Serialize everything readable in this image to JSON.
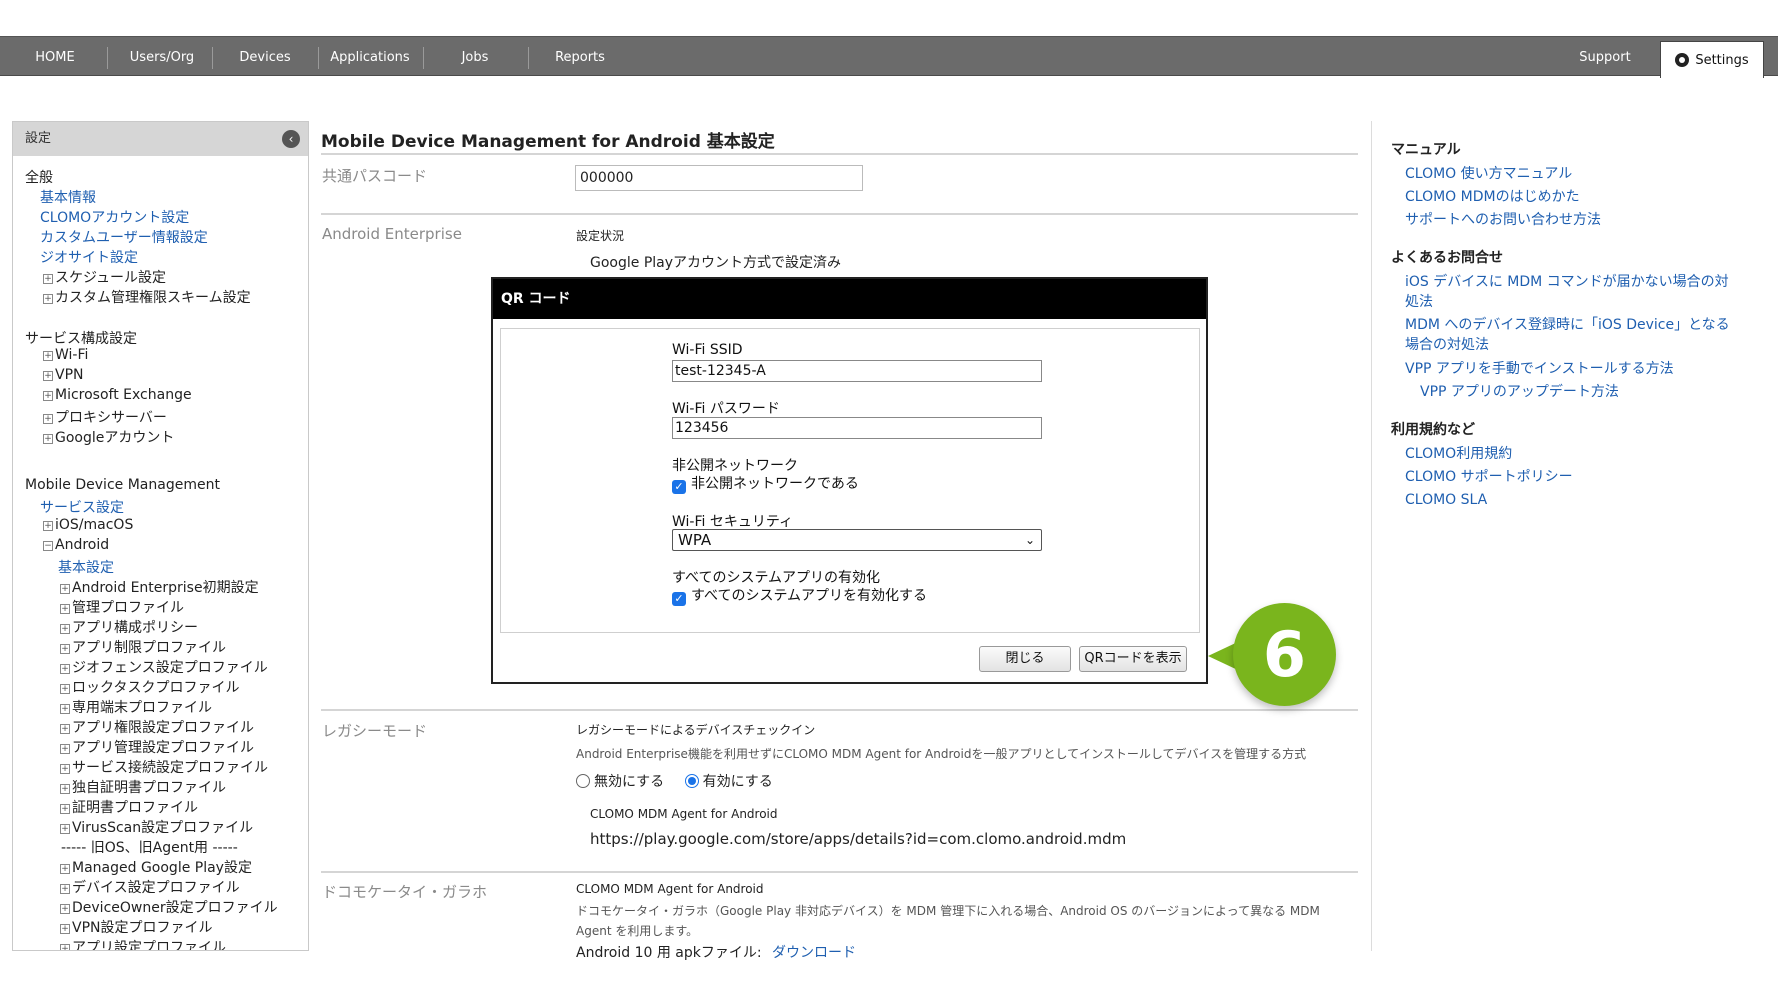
{
  "nav": {
    "items": [
      "HOME",
      "Users/Org",
      "Devices",
      "Applications",
      "Jobs",
      "Reports"
    ],
    "support": "Support",
    "settings": "Settings"
  },
  "sidebar": {
    "title": "設定",
    "collapse_icon": "chevron-left-icon",
    "lines": [
      {
        "text": "全般",
        "type": "heading"
      },
      {
        "text": "基本情報",
        "type": "link"
      },
      {
        "text": "CLOMOアカウント設定",
        "type": "link"
      },
      {
        "text": "カスタムユーザー情報設定",
        "type": "link"
      },
      {
        "text": "ジオサイト設定",
        "type": "link"
      },
      {
        "text": "スケジュール設定",
        "type": "tree"
      },
      {
        "text": "カスタム管理権限スキーム設定",
        "type": "tree"
      },
      {
        "text": "サービス構成設定",
        "type": "heading"
      },
      {
        "text": "Wi-Fi",
        "type": "tree"
      },
      {
        "text": "VPN",
        "type": "tree"
      },
      {
        "text": "Microsoft Exchange",
        "type": "tree"
      },
      {
        "text": "プロキシサーバー",
        "type": "tree"
      },
      {
        "text": "Googleアカウント",
        "type": "tree"
      },
      {
        "text": "Mobile Device Management",
        "type": "heading"
      },
      {
        "text": "サービス設定",
        "type": "link"
      },
      {
        "text": "iOS/macOS",
        "type": "tree"
      },
      {
        "text": "Android",
        "type": "tree-open"
      },
      {
        "text": "基本設定",
        "type": "link2"
      },
      {
        "text": "Android Enterprise初期設定",
        "type": "tree2"
      },
      {
        "text": "管理プロファイル",
        "type": "tree2"
      },
      {
        "text": "アプリ構成ポリシー",
        "type": "tree2"
      },
      {
        "text": "アプリ制限プロファイル",
        "type": "tree2"
      },
      {
        "text": "ジオフェンス設定プロファイル",
        "type": "tree2"
      },
      {
        "text": "ロックタスクプロファイル",
        "type": "tree2"
      },
      {
        "text": "専用端末プロファイル",
        "type": "tree2"
      },
      {
        "text": "アプリ権限設定プロファイル",
        "type": "tree2"
      },
      {
        "text": "アプリ管理設定プロファイル",
        "type": "tree2"
      },
      {
        "text": "サービス接続設定プロファイル",
        "type": "tree2"
      },
      {
        "text": "独自証明書プロファイル",
        "type": "tree2"
      },
      {
        "text": "証明書プロファイル",
        "type": "tree2"
      },
      {
        "text": "VirusScan設定プロファイル",
        "type": "tree2"
      },
      {
        "text": "----- 旧OS、旧Agent用 -----",
        "type": "sep"
      },
      {
        "text": "Managed Google Play設定",
        "type": "tree2"
      },
      {
        "text": "デバイス設定プロファイル",
        "type": "tree2"
      },
      {
        "text": "DeviceOwner設定プロファイル",
        "type": "tree2"
      },
      {
        "text": "VPN設定プロファイル",
        "type": "tree2"
      },
      {
        "text": "アプリ設定プロファイル",
        "type": "tree2"
      }
    ]
  },
  "main": {
    "title": "Mobile Device Management for Android 基本設定",
    "passcode_label": "共通パスコード",
    "passcode_value": "000000",
    "ae_label": "Android Enterprise",
    "ae_status_label": "設定状況",
    "ae_status_value": "Google Playアカウント方式で設定済み",
    "legacy_label": "レガシーモード",
    "legacy_title": "レガシーモードによるデバイスチェックイン",
    "legacy_desc": "Android Enterprise機能を利用せずにCLOMO MDM Agent for Androidを一般アプリとしてインストールしてデバイスを管理する方式",
    "legacy_off": "無効にする",
    "legacy_on": "有効にする",
    "agent_label": "CLOMO MDM Agent for Android",
    "agent_url": "https://play.google.com/store/apps/details?id=com.clomo.android.mdm",
    "docomo_label": "ドコモケータイ・ガラホ",
    "docomo_title": "CLOMO MDM Agent for Android",
    "docomo_desc1": "ドコモケータイ・ガラホ（Google Play 非対応デバイス）を MDM 管理下に入れる場合、Android OS のバージョンによって異なる MDM",
    "docomo_desc2": "Agent を利用します。",
    "docomo_apk": "Android 10 用 apkファイル:",
    "docomo_download": "ダウンロード"
  },
  "modal": {
    "title": "QR コード",
    "ssid_label": "Wi-Fi SSID",
    "ssid_value": "test-12345-A",
    "password_label": "Wi-Fi パスワード",
    "password_value": "123456",
    "hidden_label": "非公開ネットワーク",
    "hidden_check": "非公開ネットワークである",
    "security_label": "Wi-Fi セキュリティ",
    "security_value": "WPA",
    "sysapps_label": "すべてのシステムアプリの有効化",
    "sysapps_check": "すべてのシステムアプリを有効化する",
    "close_button": "閉じる",
    "show_qr_button": "QRコードを表示"
  },
  "step_marker": "6",
  "right": {
    "manual_heading": "マニュアル",
    "manual_links": [
      "CLOMO 使い方マニュアル",
      "CLOMO MDMのはじめかた",
      "サポートへのお問い合わせ方法"
    ],
    "faq_heading": "よくあるお問合せ",
    "faq_links": [
      {
        "l1": "iOS デバイスに MDM コマンドが届かない場合の対",
        "l2": "処法"
      },
      {
        "l1": "MDM へのデバイス登録時に「iOS Device」となる",
        "l2": "場合の対処法"
      },
      {
        "l1": "VPP アプリを手動でインストールする方法",
        "l2": ""
      },
      {
        "l1": "VPP アプリのアップデート方法",
        "l2": ""
      }
    ],
    "terms_heading": "利用規約など",
    "terms_links": [
      "CLOMO利用規約",
      "CLOMO サポートポリシー",
      "CLOMO SLA"
    ]
  },
  "colors": {
    "nav_bg": "#6b6b6b",
    "link": "#1f5fb0",
    "step": "#7ab51d",
    "modal_head": "#000000"
  }
}
